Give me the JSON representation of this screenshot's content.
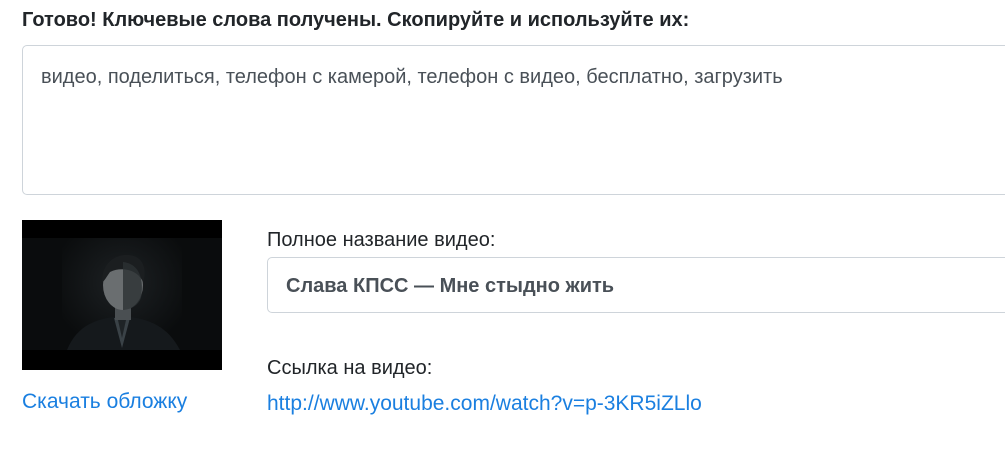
{
  "result": {
    "heading": "Готово! Ключевые слова получены. Скопируйте и используйте их:",
    "keywords": "видео, поделиться, телефон с камерой, телефон с видео, бесплатно, загрузить"
  },
  "video": {
    "download_cover_label": "Скачать обложку",
    "full_title_label": "Полное название видео:",
    "full_title_value": "Слава КПСС — Мне стыдно жить",
    "link_label": "Ссылка на видео:",
    "link_url": "http://www.youtube.com/watch?v=p-3KR5iZLlo"
  },
  "colors": {
    "link": "#1a7fe0",
    "border": "#ced4da",
    "text": "#212529"
  }
}
